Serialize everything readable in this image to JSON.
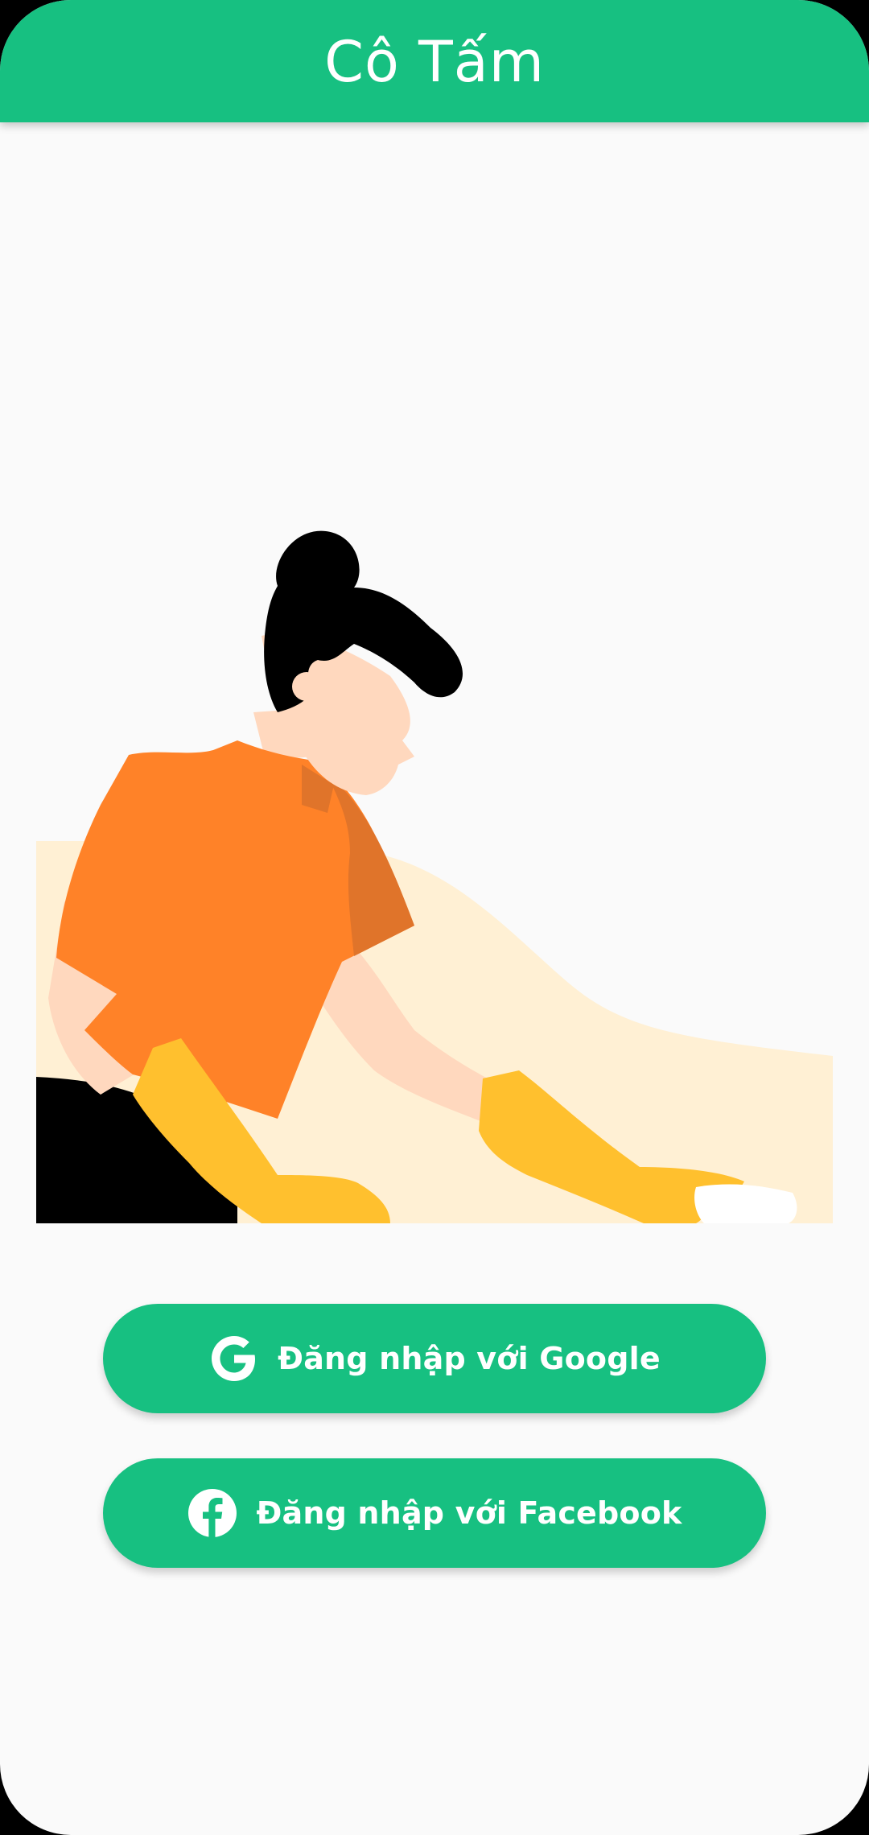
{
  "app_bar": {
    "title": "Cô Tấm"
  },
  "illustration": {
    "description_icon": "cleaning-woman-illustration"
  },
  "buttons": {
    "google": {
      "label": "Đăng nhập với Google",
      "icon": "google-icon"
    },
    "facebook": {
      "label": "Đăng nhập với Facebook",
      "icon": "facebook-icon"
    }
  },
  "colors": {
    "primary": "#17C081",
    "background": "#FAFAFA",
    "shirt": "#FF8228",
    "gloves": "#FFC02E",
    "skin": "#FFD8BE",
    "backdrop": "#FFF0D4"
  }
}
